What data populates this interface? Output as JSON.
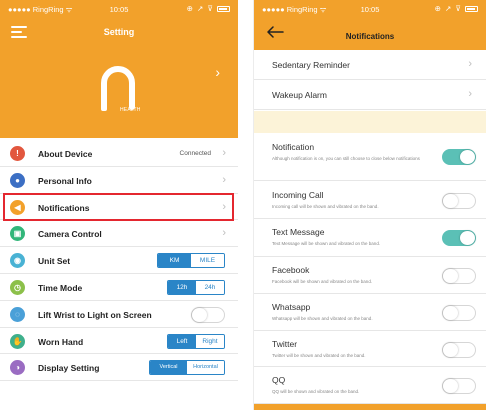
{
  "left": {
    "status": {
      "carrier": "●●●●● RingRing ᯤ",
      "time": "10:05",
      "icons": "⊕ ↗ ⊽"
    },
    "title": "Setting",
    "health_label": "HEALTH",
    "rows": [
      {
        "label": "About Device",
        "value": "Connected",
        "icon_color": "#e2573e",
        "icon_glyph": "!"
      },
      {
        "label": "Personal Info",
        "icon_color": "#3c6fc4",
        "icon_glyph": "●"
      },
      {
        "label": "Notifications",
        "icon_color": "#f2a12b",
        "icon_glyph": "◀"
      },
      {
        "label": "Camera Control",
        "icon_color": "#32b67a",
        "icon_glyph": "▣"
      },
      {
        "label": "Unit Set",
        "options": [
          "KM",
          "MILE"
        ],
        "selected": 0,
        "icon_color": "#49b2d4",
        "icon_glyph": "◉"
      },
      {
        "label": "Time Mode",
        "options": [
          "12h",
          "24h"
        ],
        "selected": 0,
        "icon_color": "#8cc04a",
        "icon_glyph": "◷"
      },
      {
        "label": "Lift Wrist to Light on Screen",
        "toggle": false,
        "icon_color": "#4aa0d8",
        "icon_glyph": "◌"
      },
      {
        "label": "Worn Hand",
        "options": [
          "Left",
          "Right"
        ],
        "selected": 0,
        "icon_color": "#3fb08c",
        "icon_glyph": "✋"
      },
      {
        "label": "Display Setting",
        "options": [
          "Vertical",
          "Horizontal"
        ],
        "selected": 0,
        "icon_color": "#9a6cc2",
        "icon_glyph": "◑"
      }
    ]
  },
  "right": {
    "status": {
      "carrier": "●●●●● RingRing ᯤ",
      "time": "10:05",
      "icons": "⊕ ↗ ⊽"
    },
    "title": "Notifications",
    "top_rows": [
      "Sedentary Reminder",
      "Wakeup Alarm"
    ],
    "items": [
      {
        "label": "Notification",
        "desc": "Although notification is on, you can still choose to close below notifications",
        "on": true
      },
      {
        "label": "Incoming Call",
        "desc": "Incoming call will be shown and vibrated on the band.",
        "on": false
      },
      {
        "label": "Text Message",
        "desc": "Text Message will be shown and vibrated on the band.",
        "on": true
      },
      {
        "label": "Facebook",
        "desc": "Facebook will be shown and vibrated on the band.",
        "on": false
      },
      {
        "label": "Whatsapp",
        "desc": "Whatsapp will be shown and vibrated on the band.",
        "on": false
      },
      {
        "label": "Twitter",
        "desc": "Twitter will be shown and vibrated on the band.",
        "on": false
      },
      {
        "label": "QQ",
        "desc": "QQ will be shown and vibrated on the band.",
        "on": false
      }
    ]
  },
  "colors": {
    "accent": "#f2a12b",
    "blue": "#2a85c7",
    "toggle_on": "#5bc0b6",
    "highlight": "#e4272f"
  }
}
